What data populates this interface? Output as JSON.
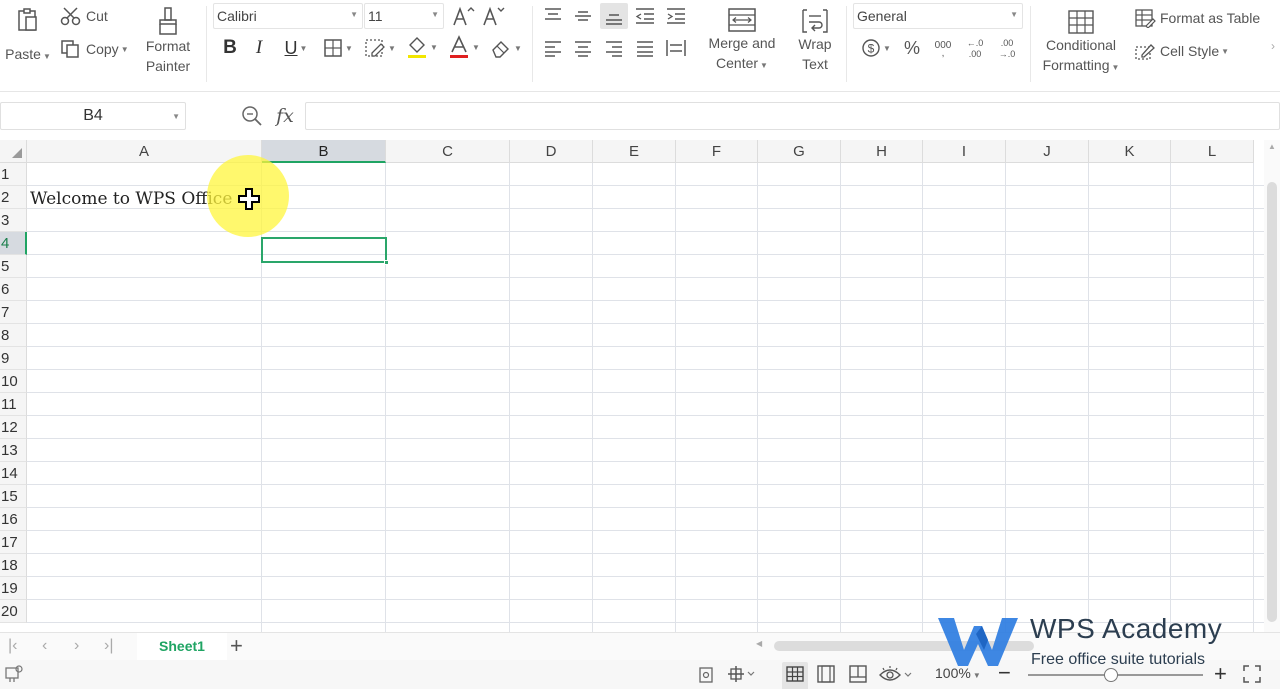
{
  "ribbon": {
    "paste": "Paste",
    "cut": "Cut",
    "copy": "Copy",
    "format_painter_1": "Format",
    "format_painter_2": "Painter",
    "font_name": "Calibri",
    "font_size": "11",
    "merge_1": "Merge and",
    "merge_2": "Center",
    "wrap_1": "Wrap",
    "wrap_2": "Text",
    "number_format": "General",
    "percent": "%",
    "conditional_1": "Conditional",
    "conditional_2": "Formatting",
    "format_as_table": "Format as Table",
    "cell_style": "Cell Style",
    "bold": "B",
    "italic": "I",
    "underline": "U"
  },
  "formula_bar": {
    "name_box": "B4",
    "fx": "fx",
    "formula": ""
  },
  "grid": {
    "columns": [
      "A",
      "B",
      "C",
      "D",
      "E",
      "F",
      "G",
      "H",
      "I",
      "J",
      "K",
      "L"
    ],
    "rows": [
      "1",
      "2",
      "3",
      "4",
      "5",
      "6",
      "7",
      "8",
      "9",
      "10",
      "11",
      "12",
      "13",
      "14",
      "15",
      "16",
      "17",
      "18",
      "19",
      "20"
    ],
    "selected_cell": "B4",
    "cells": {
      "A2": "Welcome to WPS Office"
    }
  },
  "sheets": {
    "tabs": [
      "Sheet1"
    ],
    "active": "Sheet1"
  },
  "status": {
    "zoom": "100%"
  },
  "watermark": {
    "title": "WPS Academy",
    "subtitle": "Free office suite tutorials"
  },
  "colors": {
    "accent_green": "#1fa463",
    "watermark_blue": "#2e7de1",
    "highlight_yellow": "#fff53c"
  }
}
